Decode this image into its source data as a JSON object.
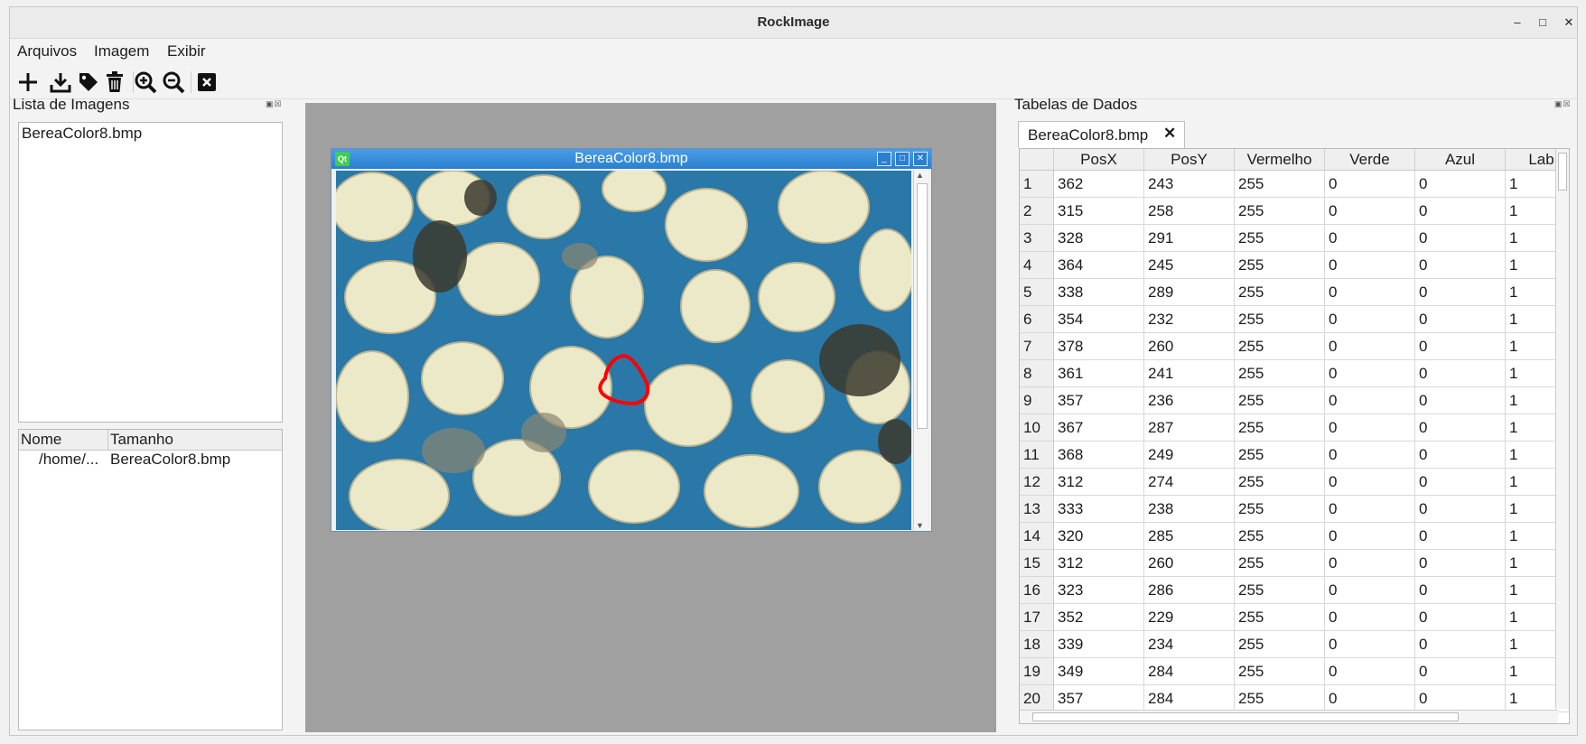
{
  "app": {
    "title": "RockImage"
  },
  "menu": [
    "Arquivos",
    "Imagem",
    "Exibir"
  ],
  "toolbar": [
    "add-icon",
    "download-icon",
    "tag-icon",
    "trash-icon",
    "zoom-in-icon",
    "zoom-out-icon",
    "close-box-icon"
  ],
  "left_dock": {
    "title": "Lista de Imagens",
    "images": [
      "BereaColor8.bmp"
    ],
    "file_table": {
      "headers": [
        "Nome",
        "Tamanho"
      ],
      "rows": [
        [
          "/home/...",
          "BereaColor8.bmp"
        ]
      ]
    }
  },
  "subwindow": {
    "title": "BereaColor8.bmp",
    "qt_badge": "Qt"
  },
  "right_dock": {
    "title": "Tabelas de Dados",
    "tab": "BereaColor8.bmp",
    "headers": [
      "PosX",
      "PosY",
      "Vermelho",
      "Verde",
      "Azul",
      "Lab"
    ],
    "rows": [
      [
        "1",
        "362",
        "243",
        "255",
        "0",
        "0",
        "1"
      ],
      [
        "2",
        "315",
        "258",
        "255",
        "0",
        "0",
        "1"
      ],
      [
        "3",
        "328",
        "291",
        "255",
        "0",
        "0",
        "1"
      ],
      [
        "4",
        "364",
        "245",
        "255",
        "0",
        "0",
        "1"
      ],
      [
        "5",
        "338",
        "289",
        "255",
        "0",
        "0",
        "1"
      ],
      [
        "6",
        "354",
        "232",
        "255",
        "0",
        "0",
        "1"
      ],
      [
        "7",
        "378",
        "260",
        "255",
        "0",
        "0",
        "1"
      ],
      [
        "8",
        "361",
        "241",
        "255",
        "0",
        "0",
        "1"
      ],
      [
        "9",
        "357",
        "236",
        "255",
        "0",
        "0",
        "1"
      ],
      [
        "10",
        "367",
        "287",
        "255",
        "0",
        "0",
        "1"
      ],
      [
        "11",
        "368",
        "249",
        "255",
        "0",
        "0",
        "1"
      ],
      [
        "12",
        "312",
        "274",
        "255",
        "0",
        "0",
        "1"
      ],
      [
        "13",
        "333",
        "238",
        "255",
        "0",
        "0",
        "1"
      ],
      [
        "14",
        "320",
        "285",
        "255",
        "0",
        "0",
        "1"
      ],
      [
        "15",
        "312",
        "260",
        "255",
        "0",
        "0",
        "1"
      ],
      [
        "16",
        "323",
        "286",
        "255",
        "0",
        "0",
        "1"
      ],
      [
        "17",
        "352",
        "229",
        "255",
        "0",
        "0",
        "1"
      ],
      [
        "18",
        "339",
        "234",
        "255",
        "0",
        "0",
        "1"
      ],
      [
        "19",
        "349",
        "284",
        "255",
        "0",
        "0",
        "1"
      ],
      [
        "20",
        "357",
        "284",
        "255",
        "0",
        "0",
        "1"
      ]
    ]
  },
  "colors": {
    "selection_outline": "#ff0000",
    "subwindow_title": "#2a7fd0",
    "mdi_background": "#a0a0a0"
  }
}
